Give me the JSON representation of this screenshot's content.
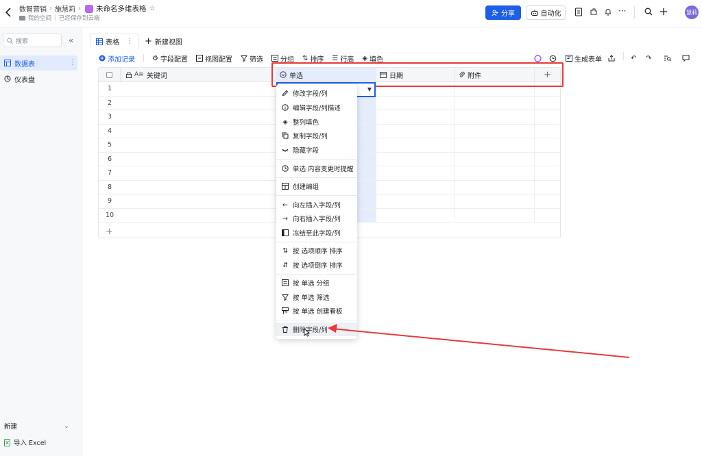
{
  "header": {
    "breadcrumb": [
      "数智营销",
      "施慧莉"
    ],
    "doc_title": "未命名多维表格",
    "location": "我的空间",
    "save_status": "已经保存到云端",
    "share_label": "分享",
    "automation_label": "自动化",
    "avatar_text": "慧莉"
  },
  "sidebar": {
    "search_placeholder": "搜索",
    "items": [
      {
        "label": "数据表",
        "icon": "table-icon",
        "active": true
      },
      {
        "label": "仪表盘",
        "icon": "dashboard-icon",
        "active": false
      }
    ],
    "new_label": "新建",
    "import_label": "导入 Excel"
  },
  "view_tabs": {
    "active": "表格",
    "new_view": "新建视图"
  },
  "toolbar": {
    "items": [
      "添加记录",
      "字段配置",
      "视图配置",
      "筛选",
      "分组",
      "排序",
      "行高",
      "填色"
    ],
    "generate_form": "生成表单"
  },
  "grid": {
    "columns": [
      {
        "label": "关键词",
        "icon": "text-field-icon"
      },
      {
        "label": "单选",
        "icon": "single-select-icon"
      },
      {
        "label": "日期",
        "icon": "date-icon"
      },
      {
        "label": "附件",
        "icon": "attachment-icon"
      }
    ],
    "add_column": "+",
    "rows": [
      "1",
      "2",
      "3",
      "4",
      "5",
      "6",
      "7",
      "8",
      "9",
      "10"
    ],
    "add_row": "+"
  },
  "context_menu": {
    "items": [
      "修改字段/列",
      "编辑字段/列描述",
      "整列填色",
      "复制字段/列",
      "隐藏字段",
      "单选 内容变更时提醒",
      "创建编组",
      "向左插入字段/列",
      "向右插入字段/列",
      "冻结至此字段/列",
      "按 选项顺序 排序",
      "按 选项倒序 排序",
      "按 单选 分组",
      "按 单选 筛选",
      "按 单选 创建看板",
      "删除字段/列"
    ],
    "highlighted": "删除字段/列"
  },
  "colors": {
    "accent": "#1d5fe6",
    "annotation_red": "#e83a3a",
    "selected_column": "#e5edfd"
  }
}
